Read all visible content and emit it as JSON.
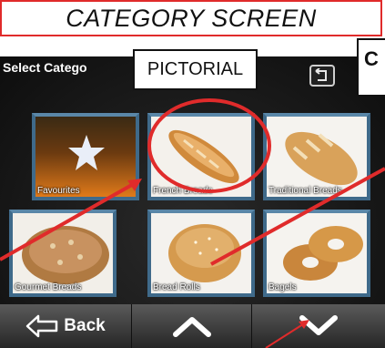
{
  "annotation": {
    "title": "CATEGORY SCREEN",
    "pictorial_label": "PICTORIAL",
    "c_label": "C"
  },
  "screen": {
    "header_label": "Select Catego",
    "categories": [
      {
        "label": "Favourites",
        "icon": "star-icon"
      },
      {
        "label": "French Breads",
        "icon": "baguette-icon"
      },
      {
        "label": "Traditional Breads",
        "icon": "loaf-icon"
      },
      {
        "label": "Gourmet Breads",
        "icon": "round-loaf-icon"
      },
      {
        "label": "Bread Rolls",
        "icon": "roll-icon"
      },
      {
        "label": "Bagels",
        "icon": "bagel-icon"
      }
    ],
    "footer": {
      "back_label": "Back"
    }
  },
  "colors": {
    "annotation_red": "#e02b2b",
    "tile_border": "#3f6a8a"
  }
}
